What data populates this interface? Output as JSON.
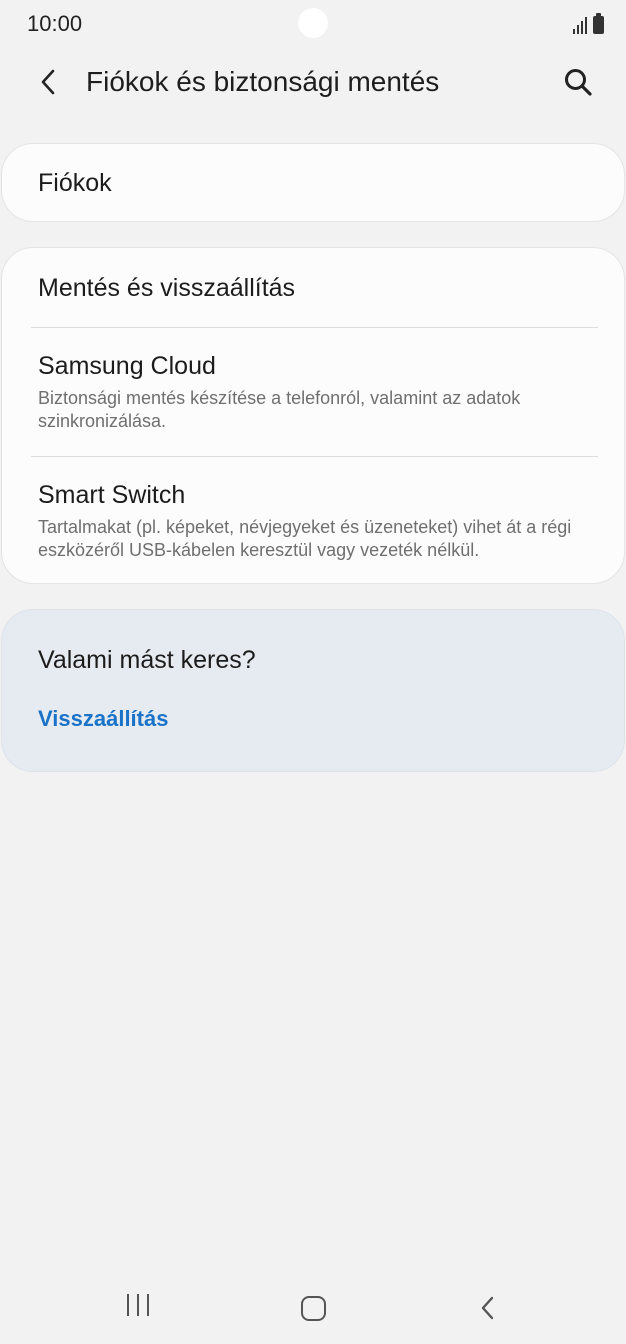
{
  "status_bar": {
    "time": "10:00"
  },
  "header": {
    "title": "Fiókok és biztonsági mentés",
    "back_icon": "chevron-left-icon",
    "search_icon": "search-icon"
  },
  "accounts_card": {
    "item_title": "Fiókok"
  },
  "backup_card": {
    "items": [
      {
        "title": "Mentés és visszaállítás",
        "subtitle": ""
      },
      {
        "title": "Samsung Cloud",
        "subtitle": "Biztonsági mentés készítése a telefonról, valamint az adatok szinkronizálása."
      },
      {
        "title": "Smart Switch",
        "subtitle": "Tartalmakat (pl. képeket, névjegyeket és üzeneteket) vihet át a régi eszközéről USB-kábelen keresztül vagy vezeték nélkül."
      }
    ]
  },
  "suggestion_card": {
    "title": "Valami mást keres?",
    "link": "Visszaállítás"
  },
  "nav_bar": {
    "recents_icon": "recents-icon",
    "home_icon": "home-icon",
    "back_icon": "back-icon"
  },
  "colors": {
    "background": "#f2f2f2",
    "card": "#fcfcfc",
    "suggestion_card": "#e6ebf1",
    "link": "#1a73c8"
  }
}
